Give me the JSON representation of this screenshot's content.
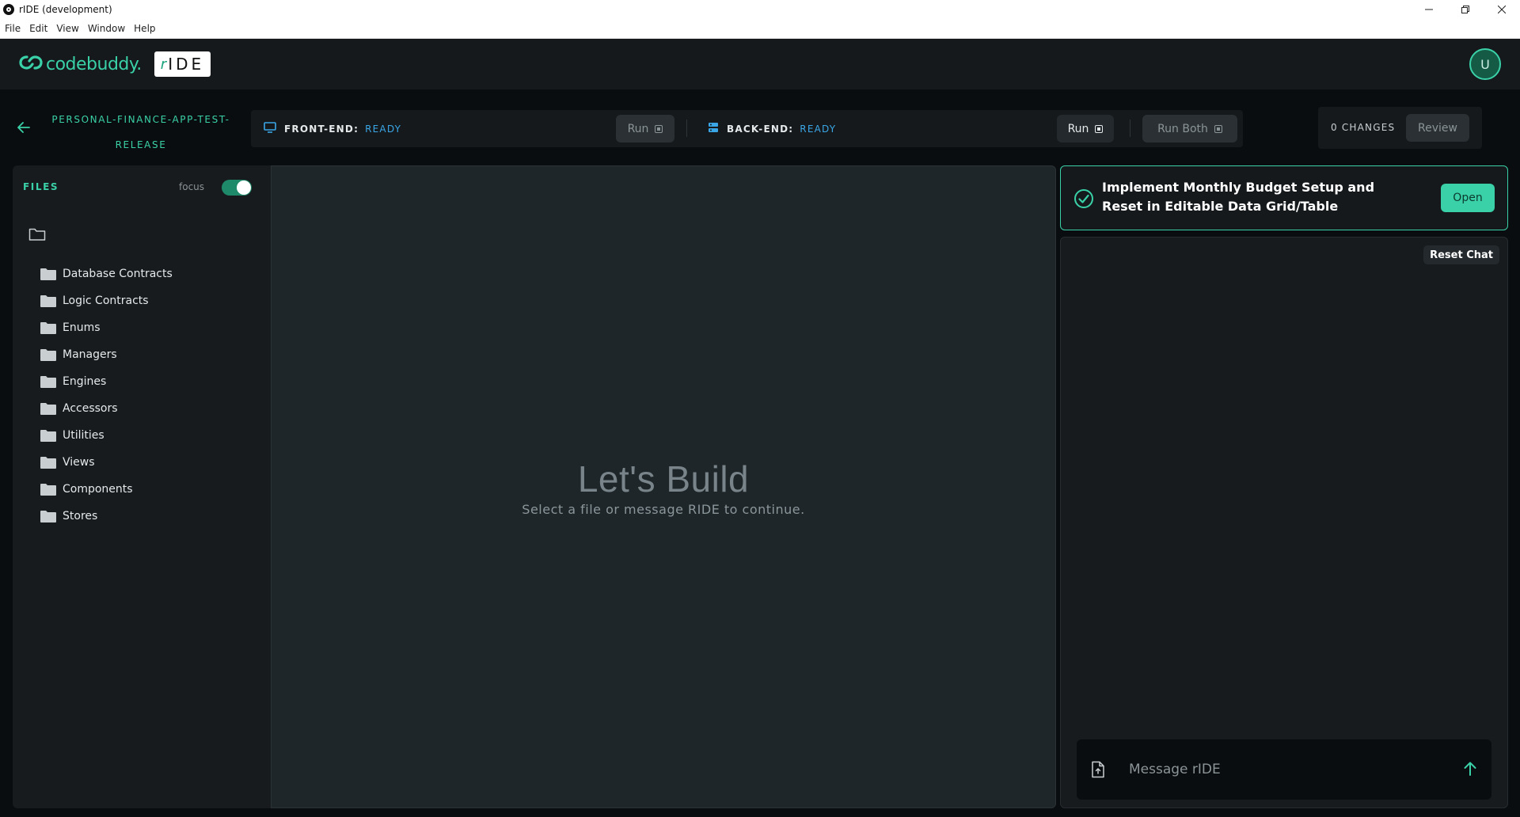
{
  "window": {
    "title": "rIDE (development)",
    "controls": [
      "minimize",
      "restore",
      "close"
    ]
  },
  "menu": [
    "File",
    "Edit",
    "View",
    "Window",
    "Help"
  ],
  "header": {
    "brand": "codebuddy.",
    "product_badge_prefix": "r",
    "product_badge": "IDE",
    "avatar_initial": "U",
    "accent": "#3ad1a8"
  },
  "project": {
    "name": "PERSONAL-FINANCE-APP-TEST-RELEASE",
    "frontend": {
      "label": "FRONT-END:",
      "status": "READY",
      "run": "Run"
    },
    "backend": {
      "label": "BACK-END:",
      "status": "READY",
      "run": "Run"
    },
    "run_both": "Run Both",
    "changes": "0 CHANGES",
    "review": "Review"
  },
  "files": {
    "title": "FILES",
    "focus_label": "focus",
    "focus_on": true,
    "folders": [
      "Database Contracts",
      "Logic Contracts",
      "Enums",
      "Managers",
      "Engines",
      "Accessors",
      "Utilities",
      "Views",
      "Components",
      "Stores"
    ]
  },
  "editor": {
    "heading": "Let's Build",
    "subheading": "Select a file or message RIDE to continue."
  },
  "task": {
    "title": "Implement Monthly Budget Setup and Reset in Editable Data Grid/Table",
    "open": "Open"
  },
  "chat": {
    "reset": "Reset Chat",
    "placeholder": "Message rIDE"
  }
}
